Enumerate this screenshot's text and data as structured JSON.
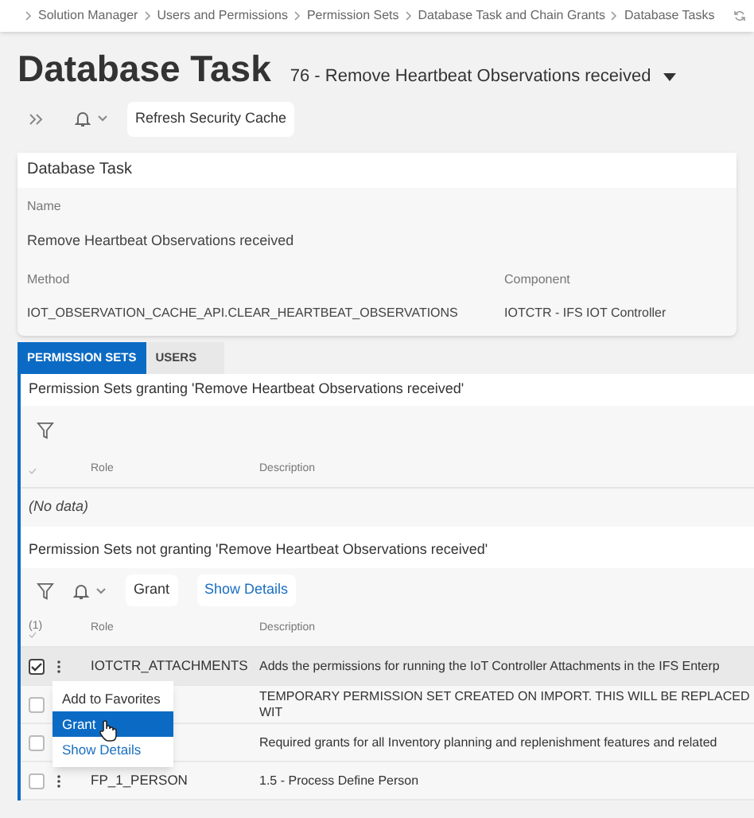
{
  "breadcrumb": [
    "Solution Manager",
    "Users and Permissions",
    "Permission Sets",
    "Database Task and Chain Grants",
    "Database Tasks"
  ],
  "title": "Database Task",
  "record": "76 - Remove Heartbeat Observations received",
  "toolbar": {
    "button": "Refresh Security Cache"
  },
  "card": {
    "title": "Database Task",
    "fields": [
      {
        "label": "Name",
        "value": "Remove Heartbeat Observations received"
      },
      {
        "label": "Method",
        "value": "IOT_OBSERVATION_CACHE_API.CLEAR_HEARTBEAT_OBSERVATIONS"
      },
      {
        "label": "Component",
        "value": "IOTCTR - IFS IOT Controller"
      }
    ]
  },
  "tabs": [
    {
      "label": "PERMISSION SETS",
      "selected": true
    },
    {
      "label": "USERS",
      "selected": false
    }
  ],
  "granting": {
    "title": "Permission Sets granting 'Remove Heartbeat Observations received'",
    "columns": [
      "Role",
      "Description"
    ],
    "empty": "(No data)"
  },
  "not_granting": {
    "title": "Permission Sets not granting 'Remove Heartbeat Observations received'",
    "buttons": [
      "Grant",
      "Show Details"
    ],
    "selected_count": "(1)",
    "columns": [
      "Role",
      "Description"
    ],
    "rows": [
      {
        "role": "IOTCTR_ATTACHMENTS",
        "description": "Adds the permissions for running the IoT Controller Attachments in the IFS Enterp",
        "checked": true
      },
      {
        "description": "TEMPORARY PERMISSION SET CREATED ON IMPORT. THIS WILL BE REPLACED WIT",
        "checked": false
      },
      {
        "description": "Required grants for all Inventory planning and replenishment features and related",
        "checked": false
      },
      {
        "role": "FP_1_PERSON",
        "description": "1.5 - Process Define Person",
        "checked": false
      }
    ]
  },
  "context_menu": [
    {
      "label": "Add to Favorites",
      "selected": false,
      "kind": "plain"
    },
    {
      "label": "Grant",
      "selected": true,
      "kind": "plain"
    },
    {
      "label": "Show Details",
      "selected": false,
      "kind": "link"
    }
  ]
}
